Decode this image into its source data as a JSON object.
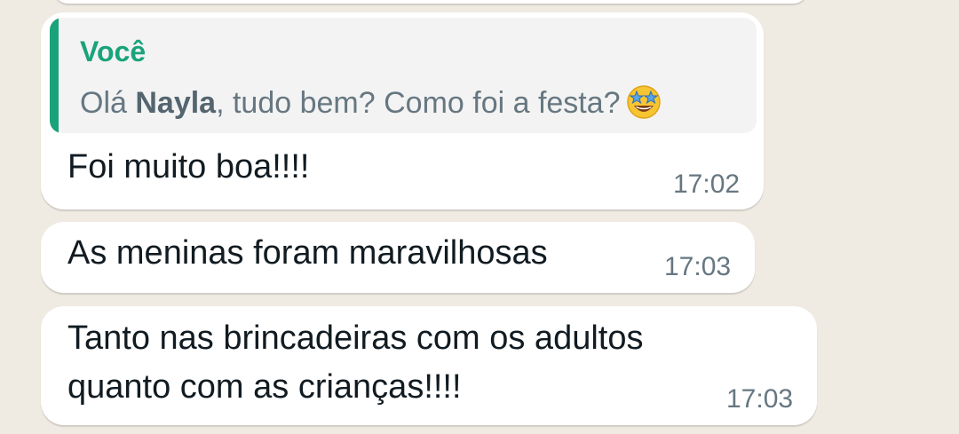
{
  "quoted_message": {
    "author": "Você",
    "text_prefix": "Olá ",
    "name": "Nayla",
    "text_suffix": ", tudo bem? Como foi a festa?",
    "emoji": "star-struck-emoji"
  },
  "messages": [
    {
      "line1": "Foi muito boa!!!!",
      "time": "17:02"
    },
    {
      "line1": "As meninas foram maravilhosas",
      "time": "17:03"
    },
    {
      "line1": "Tanto nas brincadeiras com os adultos",
      "line2": "quanto com as crianças!!!!",
      "time": "17:03"
    }
  ],
  "colors": {
    "accent": "#1aa37a",
    "bubble": "#ffffff",
    "quote_bg": "#f3f3f3",
    "text": "#111b21",
    "timestamp": "#667781"
  }
}
